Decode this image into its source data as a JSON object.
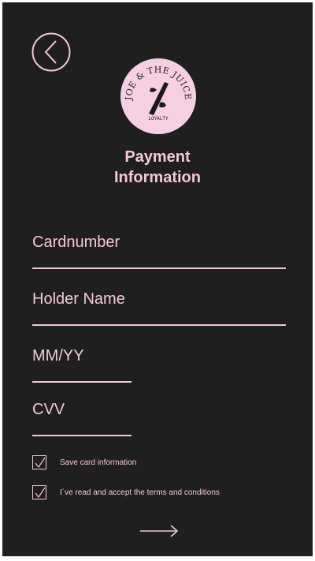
{
  "header": {
    "title_line1": "Payment",
    "title_line2": "Information"
  },
  "logo": {
    "brand_text": "JOE & THE JUICE",
    "sub_text": "LOYALTY"
  },
  "form": {
    "card_number_placeholder": "Cardnumber",
    "holder_name_placeholder": "Holder Name",
    "expiry_placeholder": "MM/YY",
    "cvv_placeholder": "CVV"
  },
  "options": {
    "save_card_label": "Save card information",
    "save_card_checked": true,
    "terms_label": "I´ve read and accept the terms and conditions",
    "terms_checked": true
  },
  "icons": {
    "back": "back-icon",
    "next": "arrow-right-icon",
    "check": "checkmark-icon"
  },
  "colors": {
    "background": "#1f1f1f",
    "accent": "#f4c6d9"
  }
}
